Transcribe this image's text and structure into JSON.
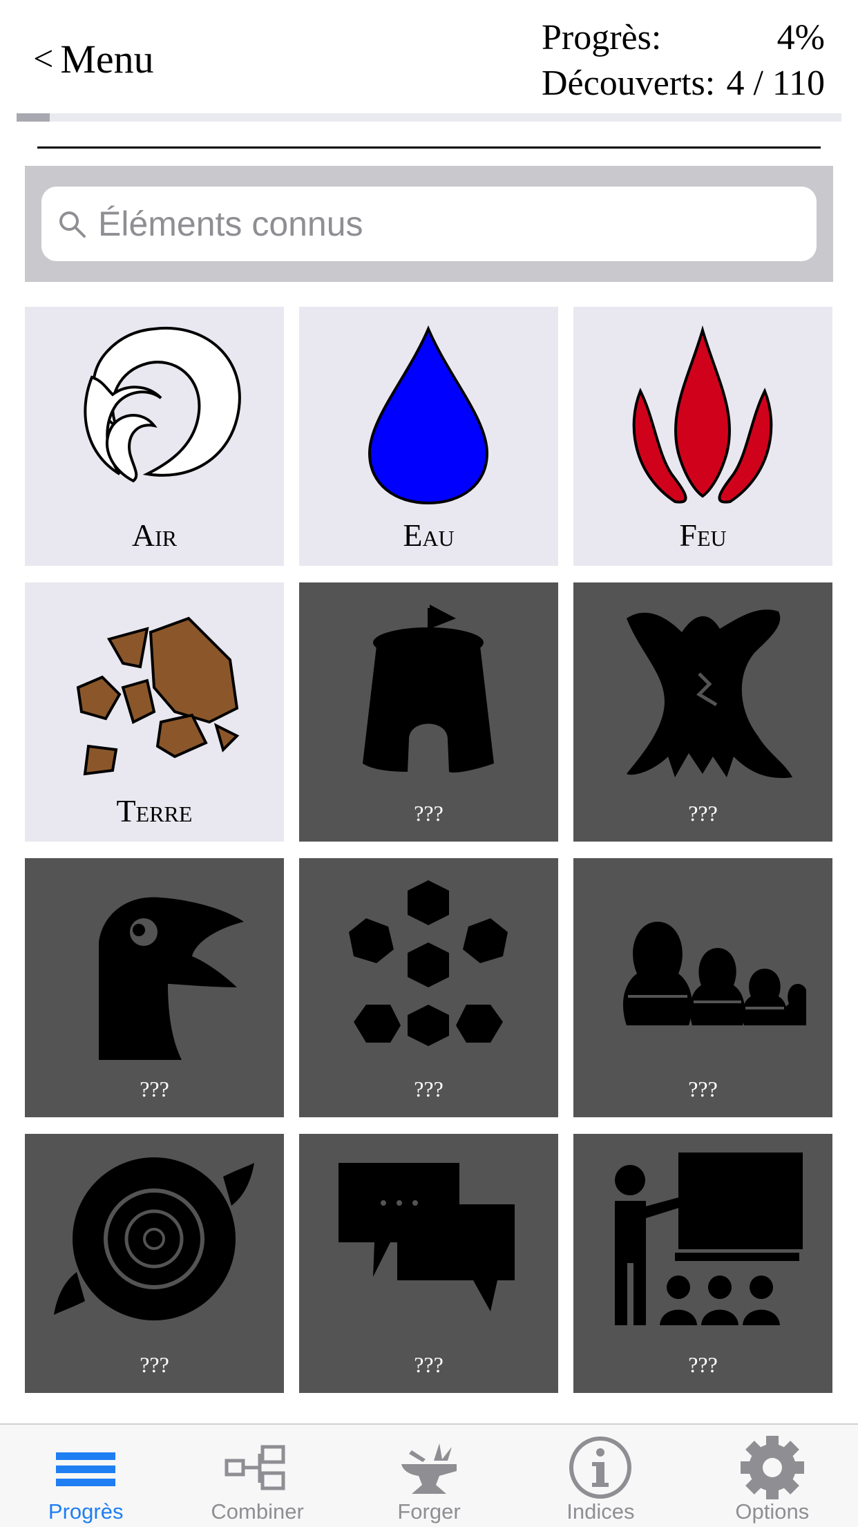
{
  "header": {
    "back_label": "Menu",
    "back_chevron": "<",
    "progress_label": "Progrès:",
    "progress_value": "4%",
    "discovered_label": "Découverts:",
    "discovered_value": "4 / 110",
    "progress_fraction": 0.04
  },
  "search": {
    "placeholder": "Éléments connus",
    "icon": "search-icon"
  },
  "elements": [
    {
      "label": "Air",
      "state": "known",
      "icon": "air-swirl-icon"
    },
    {
      "label": "Eau",
      "state": "known",
      "icon": "water-drop-icon",
      "color": "#0000ff"
    },
    {
      "label": "Feu",
      "state": "known",
      "icon": "fire-flame-icon",
      "color": "#d0021b"
    },
    {
      "label": "Terre",
      "state": "known",
      "icon": "earth-rocks-icon",
      "color": "#8b572a"
    },
    {
      "label": "???",
      "state": "locked",
      "icon": "castle-tower-icon"
    },
    {
      "label": "???",
      "state": "locked",
      "icon": "tree-trunk-icon"
    },
    {
      "label": "???",
      "state": "locked",
      "icon": "bird-head-icon"
    },
    {
      "label": "???",
      "state": "locked",
      "icon": "snowflake-icon"
    },
    {
      "label": "???",
      "state": "locked",
      "icon": "nesting-dolls-icon"
    },
    {
      "label": "???",
      "state": "locked",
      "icon": "hurricane-icon"
    },
    {
      "label": "???",
      "state": "locked",
      "icon": "speech-bubbles-icon"
    },
    {
      "label": "???",
      "state": "locked",
      "icon": "teacher-board-icon"
    }
  ],
  "tabs": [
    {
      "label": "Progrès",
      "icon": "list-icon",
      "active": true
    },
    {
      "label": "Combiner",
      "icon": "combine-icon",
      "active": false
    },
    {
      "label": "Forger",
      "icon": "anvil-icon",
      "active": false
    },
    {
      "label": "Indices",
      "icon": "info-icon",
      "active": false
    },
    {
      "label": "Options",
      "icon": "gear-icon",
      "active": false
    }
  ],
  "colors": {
    "accent": "#1f7ef2",
    "known_tile": "#e9e8f0",
    "locked_tile": "#545454",
    "search_bg": "#c8c8cd"
  }
}
